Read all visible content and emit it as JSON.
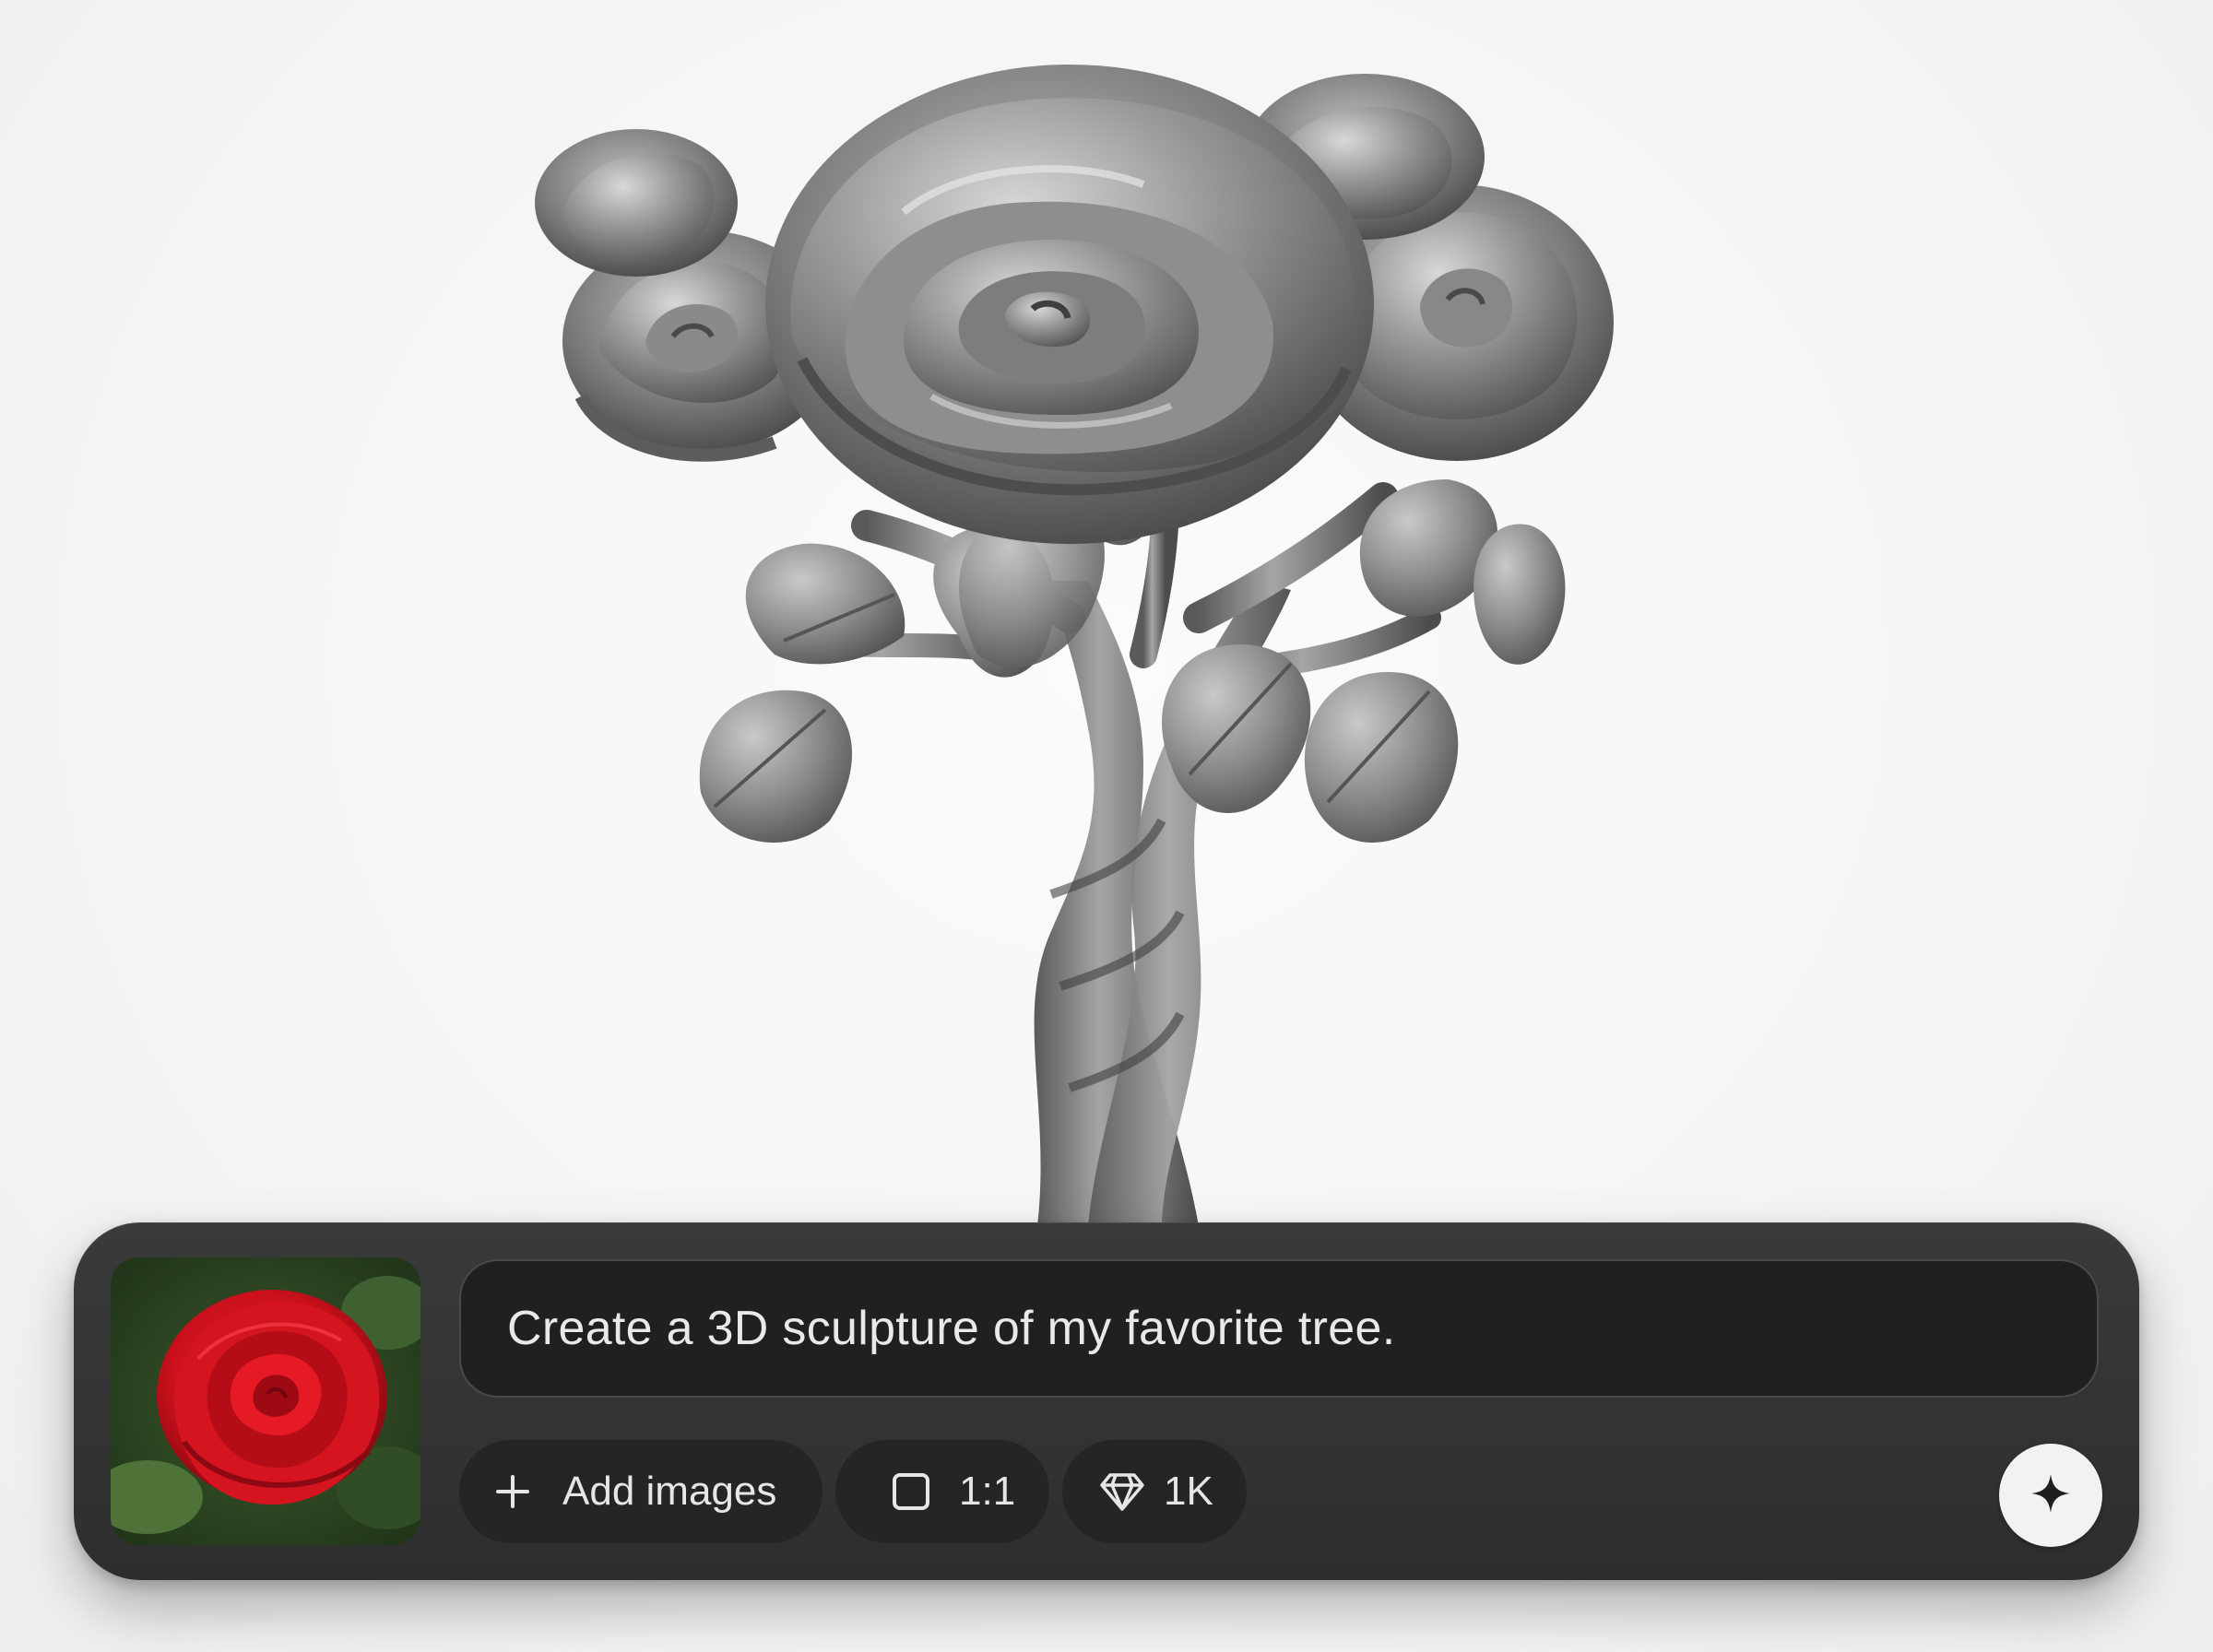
{
  "preview": {
    "subject": "grey 3D rose tree sculpture"
  },
  "composer": {
    "reference_image": "red rose photo",
    "prompt_text": "Create a 3D sculpture of my favorite tree.",
    "add_images_label": "Add images",
    "aspect_ratio_label": "1:1",
    "resolution_label": "1K",
    "icons": {
      "add": "plus-icon",
      "ratio": "square-icon",
      "resolution": "diamond-icon",
      "send": "sparkle-icon"
    }
  },
  "colors": {
    "composer_bg": "#2e2e2f",
    "chip_bg": "#252526",
    "text": "#e9e9ea",
    "send_bg": "#f2f2f2"
  }
}
